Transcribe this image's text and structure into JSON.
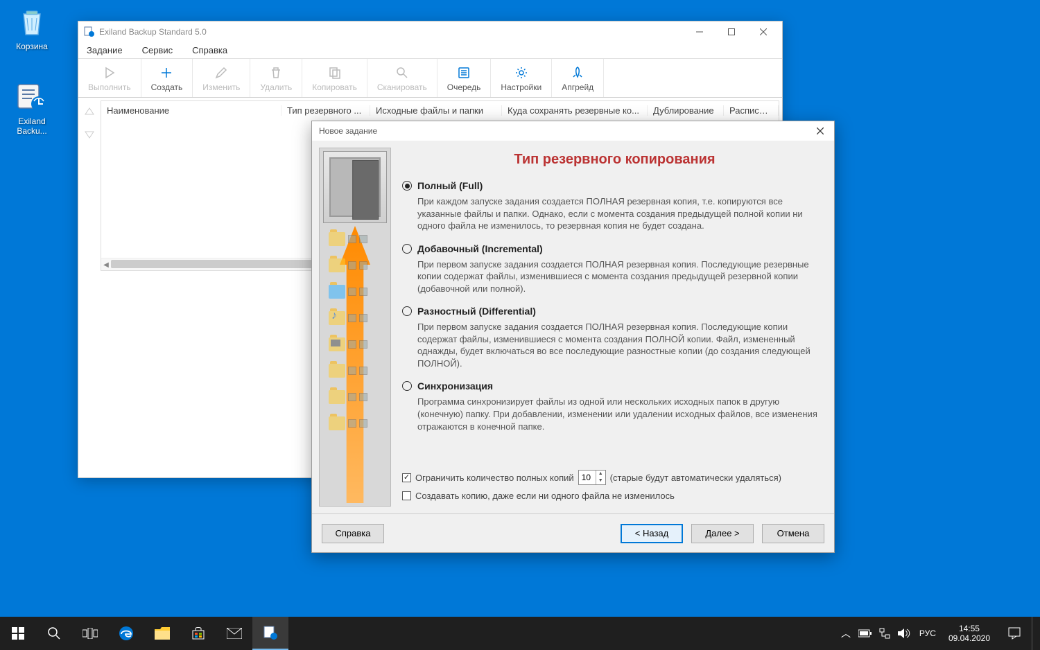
{
  "desktop": {
    "recycle": "Корзина",
    "app_shortcut": "Exiland Backu..."
  },
  "main": {
    "title": "Exiland Backup Standard 5.0",
    "menu": [
      "Задание",
      "Сервис",
      "Справка"
    ],
    "toolbar": [
      {
        "label": "Выполнить"
      },
      {
        "label": "Создать"
      },
      {
        "label": "Изменить"
      },
      {
        "label": "Удалить"
      },
      {
        "label": "Копировать"
      },
      {
        "label": "Сканировать"
      },
      {
        "label": "Очередь"
      },
      {
        "label": "Настройки"
      },
      {
        "label": "Апгрейд"
      }
    ],
    "columns": [
      "Наименование",
      "Тип резервного ...",
      "Исходные файлы и папки",
      "Куда сохранять резервные ко...",
      "Дублирование",
      "Расписани"
    ]
  },
  "dialog": {
    "title": "Новое задание",
    "heading": "Тип резервного копирования",
    "options": [
      {
        "label": "Полный (Full)",
        "desc": "При каждом запуске задания создается ПОЛНАЯ резервная копия, т.е. копируются все указанные файлы и папки. Однако, если с момента создания предыдущей полной копии ни одного файла не изменилось, то резервная копия не будет создана.",
        "checked": true
      },
      {
        "label": "Добавочный (Incremental)",
        "desc": "При первом запуске задания создается ПОЛНАЯ резервная копия. Последующие резервные копии содержат файлы, изменившиеся с момента создания предыдущей резервной копии (добавочной или полной).",
        "checked": false
      },
      {
        "label": "Разностный (Differential)",
        "desc": "При первом запуске задания создается ПОЛНАЯ резервная копия. Последующие копии содержат файлы, изменившиеся с момента создания ПОЛНОЙ копии. Файл, измененный однажды, будет включаться во все последующие разностные копии (до создания следующей ПОЛНОЙ).",
        "checked": false
      },
      {
        "label": "Синхронизация",
        "desc": "Программа синхронизирует файлы из одной или нескольких исходных папок в другую (конечную) папку. При добавлении, изменении или удалении исходных файлов, все изменения отражаются в конечной папке.",
        "checked": false
      }
    ],
    "limit_check": "Ограничить количество полных копий",
    "limit_value": "10",
    "limit_suffix": "(старые будут автоматически удаляться)",
    "always_check": "Создавать копию, даже если ни одного файла не изменилось",
    "buttons": {
      "help": "Справка",
      "back": "< Назад",
      "next": "Далее >",
      "cancel": "Отмена"
    }
  },
  "taskbar": {
    "lang": "РУС",
    "time": "14:55",
    "date": "09.04.2020"
  }
}
